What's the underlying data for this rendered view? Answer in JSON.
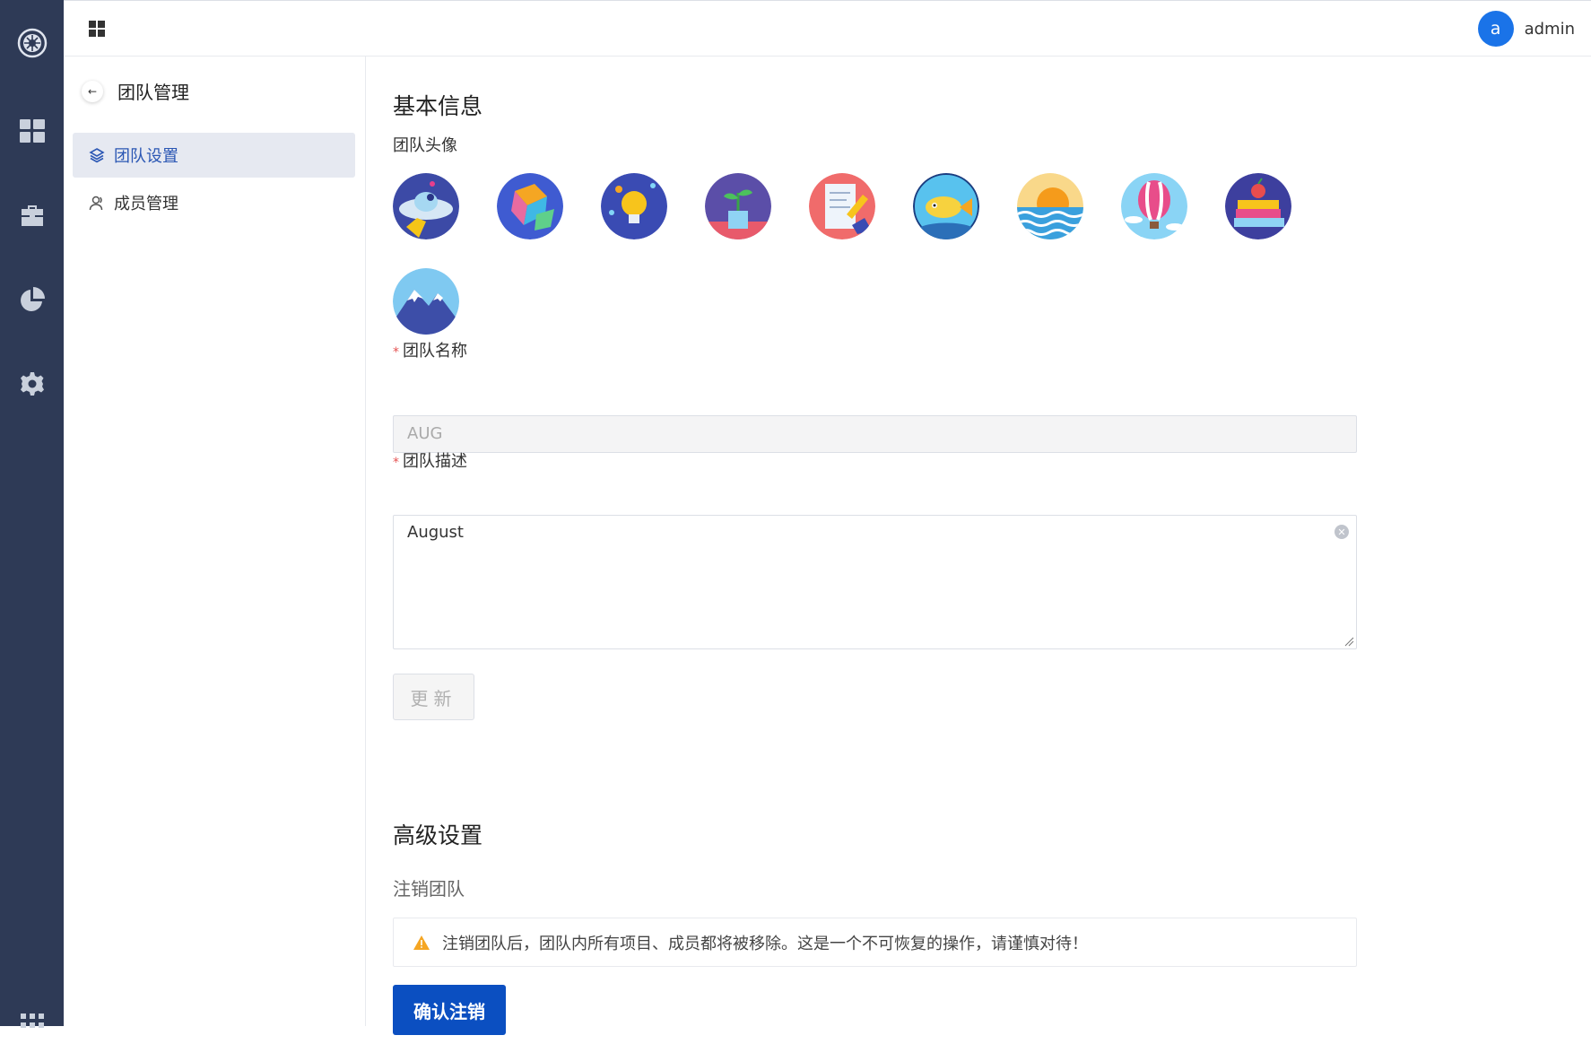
{
  "header": {
    "avatar_letter": "a",
    "username": "admin"
  },
  "leftnav": {
    "icons": [
      "logo-icon",
      "dashboard-icon",
      "toolbox-icon",
      "pie-chart-icon",
      "settings-icon",
      "apps-grid-icon"
    ]
  },
  "subnav": {
    "title": "团队管理",
    "back_symbol": "←",
    "items": [
      {
        "label": "团队设置",
        "icon": "layers-icon",
        "active": true
      },
      {
        "label": "成员管理",
        "icon": "user-icon",
        "active": false
      }
    ]
  },
  "basic": {
    "title": "基本信息",
    "avatar_label": "团队头像",
    "avatars": [
      "ufo",
      "cubes",
      "lightbulb",
      "plant",
      "document-pen",
      "fish",
      "sunset-sea",
      "hot-air-balloon",
      "books",
      "mountain"
    ],
    "name_label": "团队名称",
    "name_value": "AUG",
    "desc_label": "团队描述",
    "desc_value": "August",
    "required_mark": "*",
    "update_button": "更新"
  },
  "advanced": {
    "title": "高级设置",
    "delete_title": "注销团队",
    "warning": "注销团队后，团队内所有项目、成员都将被移除。这是一个不可恢复的操作，请谨慎对待！",
    "confirm_button": "确认注销"
  },
  "colors": {
    "sidebar": "#2e3a56",
    "primary": "#0b4fc1",
    "avatar_bg": "#1a73e8",
    "warning": "#f5a623"
  }
}
